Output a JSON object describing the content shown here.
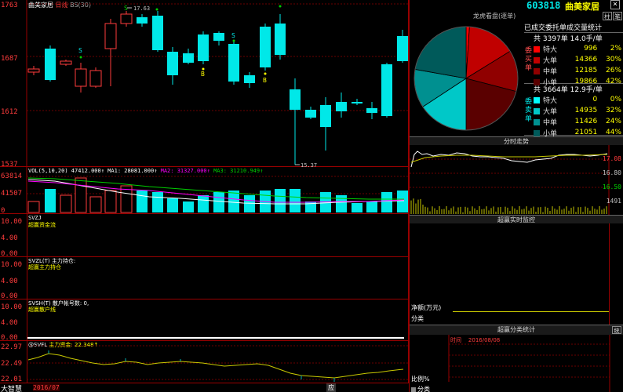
{
  "stock_chart": {
    "title": "曲美家居",
    "period": "日线",
    "indicator": "BS(30)",
    "axis": [
      "1763",
      "1687",
      "1612",
      "1537"
    ],
    "high_label": "17.63",
    "low_label": "15.37",
    "signals": [
      "S",
      "S",
      "S",
      "B",
      "B"
    ]
  },
  "vol": {
    "label": "VOL(5,10,20)",
    "vol_val": "47412.000",
    "ma1_label": "MA1:",
    "ma1": "28081.000",
    "ma2_label": "MA2:",
    "ma2": "31327.000",
    "ma3_label": "MA3:",
    "ma3": "31210.949",
    "axis": [
      "63814",
      "41507",
      "0"
    ]
  },
  "panels": [
    {
      "code": "SVZJ",
      "name": "超赢资金流",
      "axis": [
        "10.00",
        "4.00",
        "0.00"
      ]
    },
    {
      "code": "SVZL(T)",
      "sub": "主力持仓:",
      "name": "超赢主力持仓",
      "axis": [
        "10.00",
        "4.00",
        "0.00"
      ]
    },
    {
      "code": "SVSH(T)",
      "sub": "散户帐号数:",
      "sub_val": "0,",
      "name": "超赢散户线",
      "axis": [
        "10.00",
        "4.00",
        "0.00"
      ]
    },
    {
      "code": "@SVFL",
      "sub": "主力资金:",
      "sub_val": "22.348",
      "axis": [
        "22.97",
        "22.49",
        "22.01"
      ]
    }
  ],
  "bottom": {
    "logo": "大智慧",
    "date": "2016/07",
    "tab": "应"
  },
  "right": {
    "code": "603818",
    "name": "曲美家居",
    "btn_a": "柱",
    "btn_b": "笔",
    "close": "×",
    "tiger": "龙虎看盘(逐单)",
    "order_title": "已成交委托单成交量统计",
    "buy_total": "共 3397单 14.0手/单",
    "buy_side": "委买单",
    "buy_rows": [
      {
        "label": "特大",
        "count": "996",
        "pct": "2%",
        "color": "#ff0000"
      },
      {
        "label": "大单",
        "count": "14366",
        "pct": "30%",
        "color": "#c00000"
      },
      {
        "label": "中单",
        "count": "12185",
        "pct": "26%",
        "color": "#900000"
      },
      {
        "label": "小单",
        "count": "19866",
        "pct": "42%",
        "color": "#5a0000"
      }
    ],
    "sell_total": "共 3664单 12.9手/单",
    "sell_side": "委卖单",
    "sell_rows": [
      {
        "label": "特大",
        "count": "0",
        "pct": "0%",
        "color": "#00ffff"
      },
      {
        "label": "大单",
        "count": "14935",
        "pct": "32%",
        "color": "#00c8c8"
      },
      {
        "label": "中单",
        "count": "11426",
        "pct": "24%",
        "color": "#009090"
      },
      {
        "label": "小单",
        "count": "21051",
        "pct": "44%",
        "color": "#005a5a"
      }
    ],
    "intraday_title": "分时走势",
    "intraday_axis": [
      "17.08",
      "16.80",
      "16.50",
      "1491"
    ],
    "monitor_title": "超赢实时监控",
    "net_label": "净额(万元)",
    "cat_label": "分类",
    "stats_title": "超赢分类统计",
    "time_label": "时间",
    "time_val": "2016/08/08",
    "ratio_label": "比例%",
    "stats_btn": "统",
    "bottom_cat": "分类"
  }
}
